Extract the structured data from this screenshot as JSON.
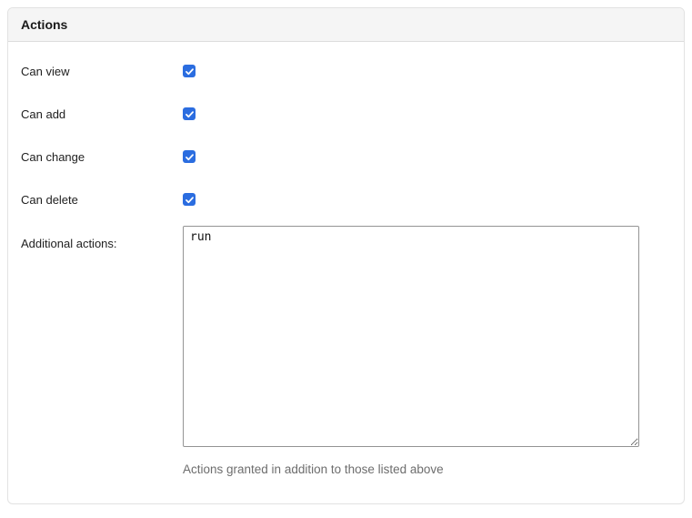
{
  "fieldset": {
    "title": "Actions",
    "permissions": [
      {
        "label": "Can view",
        "checked": true
      },
      {
        "label": "Can add",
        "checked": true
      },
      {
        "label": "Can change",
        "checked": true
      },
      {
        "label": "Can delete",
        "checked": true
      }
    ],
    "additional_actions": {
      "label": "Additional actions:",
      "value": "run",
      "help": "Actions granted in addition to those listed above"
    }
  },
  "icons": {
    "checkmark": "check-icon"
  },
  "colors": {
    "checkbox_accent": "#2b6de0",
    "checkmark": "#ffffff",
    "panel_border": "#e2e2e2",
    "header_background": "#f5f5f5",
    "header_border": "#dcdcdc",
    "label_text": "#1e1e1e",
    "textarea_border": "#949494",
    "help_text": "#6d6d6d"
  }
}
